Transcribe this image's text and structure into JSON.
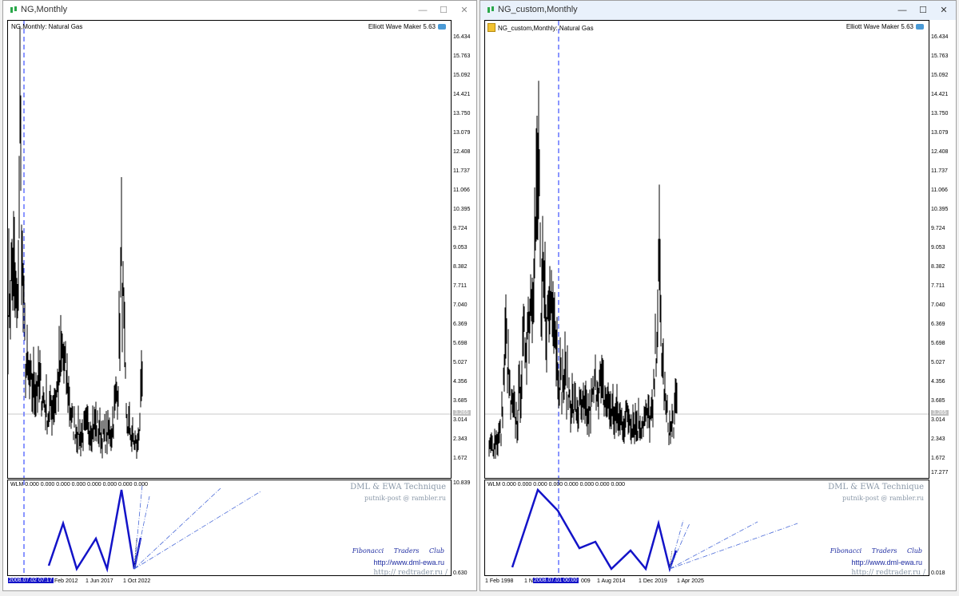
{
  "windows": [
    {
      "title": "NG,Monthly",
      "symbol_label": "NG,Monthly:  Natural Gas",
      "indicator_name": "Elliott Wave Maker 5.63",
      "price_scale": [
        "16.434",
        "15.763",
        "15.092",
        "14.421",
        "13.750",
        "13.079",
        "12.408",
        "11.737",
        "11.066",
        "10.395",
        "9.724",
        "9.053",
        "8.382",
        "7.711",
        "7.040",
        "6.369",
        "5.698",
        "5.027",
        "4.356",
        "3.685",
        "3.014",
        "2.343",
        "1.672"
      ],
      "current_price": "3.265",
      "wlm_label": "WLM 0.000 0.000 0.000 0.000 0.000 0.000 0.000 0.000",
      "indicator_scale": [
        "10.839",
        "0.630"
      ],
      "time_labels": [
        "Feb 2012",
        "1 Jun 2017",
        "1 Oct 2022"
      ],
      "crosshair_time": "2008.07.02 07:17",
      "watermark": {
        "title": "DML & EWA Technique",
        "email": "putnik-post @ rambler.ru",
        "club": "Fibonacci Traders Club",
        "url1": "http://www.dml-ewa.ru",
        "url2": "http:// redtrader.ru /"
      }
    },
    {
      "title": "NG_custom,Monthly",
      "symbol_label": "NG_custom,Monthly:  Natural Gas",
      "indicator_name": "Elliott Wave Maker 5.63",
      "price_scale": [
        "16.434",
        "15.763",
        "15.092",
        "14.421",
        "13.750",
        "13.079",
        "12.408",
        "11.737",
        "11.066",
        "10.395",
        "9.724",
        "9.053",
        "8.382",
        "7.711",
        "7.040",
        "6.369",
        "5.698",
        "5.027",
        "4.356",
        "3.685",
        "3.014",
        "2.343",
        "1.672"
      ],
      "current_price": "3.265",
      "wlm_label": "WLM 0.000 0.000 0.000 0.000 0.000 0.000 0.000 0.000",
      "indicator_scale": [
        "17.277",
        "0.018"
      ],
      "time_labels": [
        "1 Feb 1998",
        "1 N",
        "009",
        "1 Aug 2014",
        "1 Dec 2019",
        "1 Apr 2025"
      ],
      "crosshair_time": "2008.07.01 00:00",
      "watermark": {
        "title": "DML & EWA Technique",
        "email": "putnik-post @ rambler.ru",
        "club": "Fibonacci Traders Club",
        "url1": "http://www.dml-ewa.ru",
        "url2": "http:// redtrader.ru /"
      }
    }
  ],
  "window_buttons": {
    "minimize": "—",
    "maximize": "☐",
    "close": "✕"
  },
  "colors": {
    "wave": "#1313c8",
    "crosshair": "#3c50ff",
    "icon_green": "#2aa84a",
    "price_bar": "#000000"
  }
}
